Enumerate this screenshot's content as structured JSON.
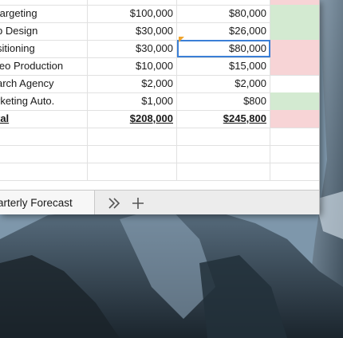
{
  "sheet": {
    "rows": [
      {
        "name": "Targeting",
        "budget": "$100,000",
        "actual": "$80,000",
        "status_color": "#d3ead1"
      },
      {
        "name": "Web Design",
        "budget": "$30,000",
        "actual": "$26,000",
        "status_color": "#d3ead1"
      },
      {
        "name": "Positioning",
        "budget": "$30,000",
        "actual": "$80,000",
        "status_color": "#f7d4d6"
      },
      {
        "name": "Video Production",
        "budget": "$10,000",
        "actual": "$15,000",
        "status_color": "#f7d4d6"
      },
      {
        "name": "Research Agency",
        "budget": "$2,000",
        "actual": "$2,000",
        "status_color": "#ffffff"
      },
      {
        "name": "Marketing Auto.",
        "budget": "$1,000",
        "actual": "$800",
        "status_color": "#d3ead1"
      },
      {
        "name": "Total",
        "budget": "$208,000",
        "actual": "$245,800",
        "status_color": "#f7d4d6"
      }
    ],
    "visible_names": [
      "targeting",
      "b Design",
      "sitioning",
      "leo Production",
      "arch Agency",
      "rketing Auto.",
      "tal"
    ]
  },
  "tabbar": {
    "active_tab": "arterly Forecast",
    "more_icon": "double-chevron-right-icon",
    "add_icon": "plus-icon"
  },
  "colors": {
    "good": "#d3ead1",
    "over": "#f7d4d6",
    "selection": "#3b7fd6",
    "comment": "#f0a42c"
  }
}
